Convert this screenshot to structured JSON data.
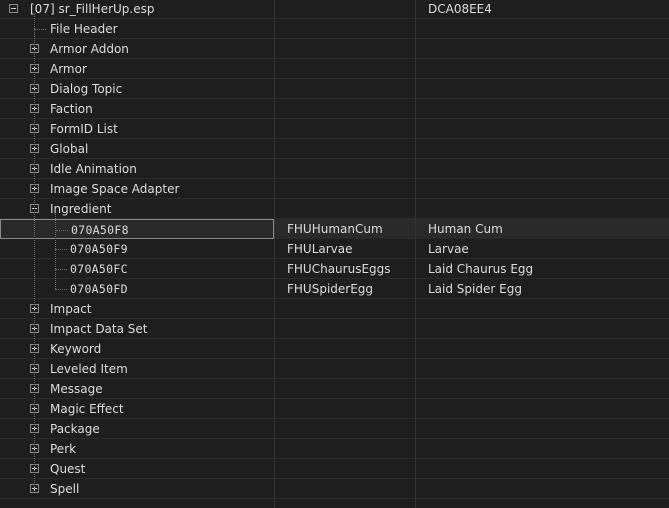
{
  "plugin": {
    "name": "[07] sr_FillHerUp.esp",
    "checksum": "DCA08EE4"
  },
  "groups": [
    {
      "label": "File Header",
      "expander": "none"
    },
    {
      "label": "Armor Addon",
      "expander": "plus"
    },
    {
      "label": "Armor",
      "expander": "plus"
    },
    {
      "label": "Dialog Topic",
      "expander": "plus"
    },
    {
      "label": "Faction",
      "expander": "plus"
    },
    {
      "label": "FormID List",
      "expander": "plus"
    },
    {
      "label": "Global",
      "expander": "plus"
    },
    {
      "label": "Idle Animation",
      "expander": "plus"
    },
    {
      "label": "Image Space Adapter",
      "expander": "plus"
    },
    {
      "label": "Ingredient",
      "expander": "minus",
      "records": [
        {
          "form_id": "070A50F8",
          "editor_id": "FHUHumanCum",
          "full_name": "Human Cum",
          "selected": true
        },
        {
          "form_id": "070A50F9",
          "editor_id": "FHULarvae",
          "full_name": "Larvae",
          "selected": false
        },
        {
          "form_id": "070A50FC",
          "editor_id": "FHUChaurusEggs",
          "full_name": "Laid Chaurus Egg",
          "selected": false
        },
        {
          "form_id": "070A50FD",
          "editor_id": "FHUSpiderEgg",
          "full_name": "Laid Spider Egg",
          "selected": false
        }
      ]
    },
    {
      "label": "Impact",
      "expander": "plus"
    },
    {
      "label": "Impact Data Set",
      "expander": "plus"
    },
    {
      "label": "Keyword",
      "expander": "plus"
    },
    {
      "label": "Leveled Item",
      "expander": "plus"
    },
    {
      "label": "Message",
      "expander": "plus"
    },
    {
      "label": "Magic Effect",
      "expander": "plus"
    },
    {
      "label": "Package",
      "expander": "plus"
    },
    {
      "label": "Perk",
      "expander": "plus"
    },
    {
      "label": "Quest",
      "expander": "plus"
    },
    {
      "label": "Spell",
      "expander": "plus"
    }
  ],
  "icons": {
    "expand": "plus-box-icon",
    "collapse": "minus-box-icon"
  },
  "colors": {
    "background": "#1e1e1e",
    "text": "#dcdcdc",
    "selected_row": "#2a2a2a",
    "focus_border": "#8a8a8a"
  }
}
